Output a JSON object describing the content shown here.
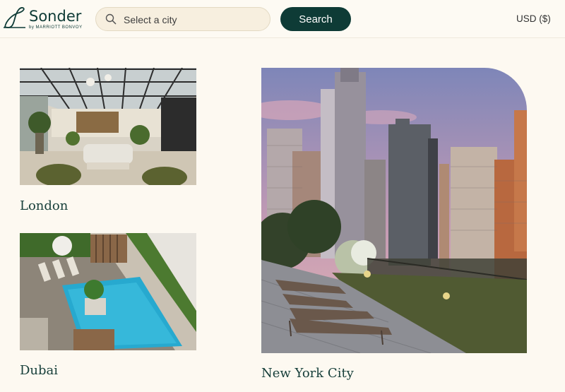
{
  "brand": {
    "name": "Sonder",
    "tagline": "by MARRIOTT BONVOY"
  },
  "search": {
    "placeholder": "Select a city",
    "button_label": "Search"
  },
  "currency": {
    "label": "USD ($)"
  },
  "cities": [
    {
      "name": "London"
    },
    {
      "name": "Dubai"
    },
    {
      "name": "New York City"
    }
  ],
  "colors": {
    "brand_green": "#0e3b36",
    "background": "#fdf9f1",
    "search_field": "#f7efdf"
  }
}
